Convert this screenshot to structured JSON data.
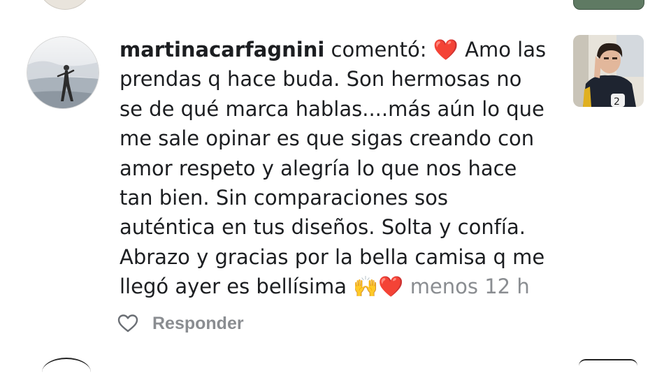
{
  "comment": {
    "username": "martinacarfagnini",
    "action": "comentó:",
    "lines": [
      "Amo las",
      "prendas q hace buda. Son hermosas no",
      "se de qué marca hablas....más aún lo que",
      "me sale opinar es que sigas creando con",
      "amor respeto y alegría lo que nos hace",
      "tan bien. Sin comparaciones sos",
      "auténtica en tus diseños. Solta y confía.",
      "Abrazo y gracias por la bella camisa q me",
      "llegó ayer es bellísima"
    ],
    "lead_emoji": "❤️",
    "end_emojis": [
      "🙌",
      "❤️"
    ],
    "time": "menos 12 h"
  },
  "actions": {
    "like_icon": "heart-outline-icon",
    "reply_label": "Responder"
  },
  "colors": {
    "text": "#1c1e21",
    "muted": "#8a8d91",
    "heart": "#e0232e"
  }
}
